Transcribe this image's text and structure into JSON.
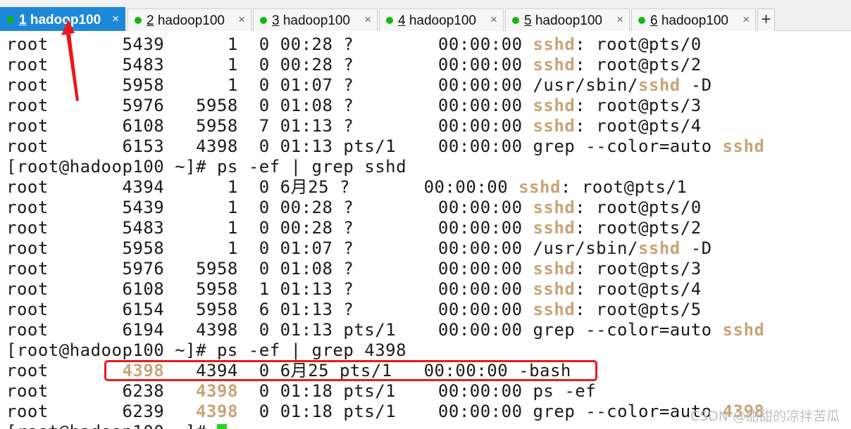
{
  "tabs": [
    {
      "num": "1",
      "name": "hadoop100",
      "active": true
    },
    {
      "num": "2",
      "name": "hadoop100",
      "active": false
    },
    {
      "num": "3",
      "name": "hadoop100",
      "active": false
    },
    {
      "num": "4",
      "name": "hadoop100",
      "active": false
    },
    {
      "num": "5",
      "name": "hadoop100",
      "active": false
    },
    {
      "num": "6",
      "name": "hadoop100",
      "active": false
    }
  ],
  "close_glyph": "×",
  "new_tab_glyph": "+",
  "colors": {
    "active_tab": "#1e88d8",
    "status_dot": "#13b613",
    "highlight": "#c9a477",
    "cursor": "#1ed81e",
    "annotation": "#e8191c"
  },
  "icons": {
    "tab_status": "green-dot-icon",
    "tab_close": "close-icon",
    "new_tab": "plus-icon",
    "annotation": "red-arrow-icon"
  },
  "terminal": {
    "lines": [
      [
        {
          "t": "root       5439      1  0 00:28 ?        00:00:00 "
        },
        {
          "t": "sshd",
          "hl": true
        },
        {
          "t": ": root@pts/0"
        }
      ],
      [
        {
          "t": "root       5483      1  0 00:28 ?        00:00:00 "
        },
        {
          "t": "sshd",
          "hl": true
        },
        {
          "t": ": root@pts/2"
        }
      ],
      [
        {
          "t": "root       5958      1  0 01:07 ?        00:00:00 /usr/sbin/"
        },
        {
          "t": "sshd",
          "hl": true
        },
        {
          "t": " -D"
        }
      ],
      [
        {
          "t": "root       5976   5958  0 01:08 ?        00:00:00 "
        },
        {
          "t": "sshd",
          "hl": true
        },
        {
          "t": ": root@pts/3"
        }
      ],
      [
        {
          "t": "root       6108   5958  7 01:13 ?        00:00:00 "
        },
        {
          "t": "sshd",
          "hl": true
        },
        {
          "t": ": root@pts/4"
        }
      ],
      [
        {
          "t": "root       6153   4398  0 01:13 pts/1    00:00:00 grep --color=auto "
        },
        {
          "t": "sshd",
          "hl": true
        }
      ],
      [
        {
          "t": "[root@hadoop100 ~]# ps -ef | grep sshd"
        }
      ],
      [
        {
          "t": "root       4394      1  0 6月25 ?       00:00:00 "
        },
        {
          "t": "sshd",
          "hl": true
        },
        {
          "t": ": root@pts/1"
        }
      ],
      [
        {
          "t": "root       5439      1  0 00:28 ?        00:00:00 "
        },
        {
          "t": "sshd",
          "hl": true
        },
        {
          "t": ": root@pts/0"
        }
      ],
      [
        {
          "t": "root       5483      1  0 00:28 ?        00:00:00 "
        },
        {
          "t": "sshd",
          "hl": true
        },
        {
          "t": ": root@pts/2"
        }
      ],
      [
        {
          "t": "root       5958      1  0 01:07 ?        00:00:00 /usr/sbin/"
        },
        {
          "t": "sshd",
          "hl": true
        },
        {
          "t": " -D"
        }
      ],
      [
        {
          "t": "root       5976   5958  0 01:08 ?        00:00:00 "
        },
        {
          "t": "sshd",
          "hl": true
        },
        {
          "t": ": root@pts/3"
        }
      ],
      [
        {
          "t": "root       6108   5958  1 01:13 ?        00:00:00 "
        },
        {
          "t": "sshd",
          "hl": true
        },
        {
          "t": ": root@pts/4"
        }
      ],
      [
        {
          "t": "root       6154   5958  6 01:13 ?        00:00:00 "
        },
        {
          "t": "sshd",
          "hl": true
        },
        {
          "t": ": root@pts/5"
        }
      ],
      [
        {
          "t": "root       6194   4398  0 01:13 pts/1    00:00:00 grep --color=auto "
        },
        {
          "t": "sshd",
          "hl": true
        }
      ],
      [
        {
          "t": "[root@hadoop100 ~]# ps -ef | grep 4398"
        }
      ],
      [
        {
          "t": "root       "
        },
        {
          "t": "4398",
          "hl": true
        },
        {
          "t": "   4394  0 6月25 pts/1   00:00:00 -bash"
        }
      ],
      [
        {
          "t": "root       6238   "
        },
        {
          "t": "4398",
          "hl": true
        },
        {
          "t": "  0 01:18 pts/1    00:00:00 ps -ef"
        }
      ],
      [
        {
          "t": "root       6239   "
        },
        {
          "t": "4398",
          "hl": true
        },
        {
          "t": "  0 01:18 pts/1    00:00:00 grep --color=auto "
        },
        {
          "t": "4398",
          "hl": true
        }
      ],
      [
        {
          "t": "[root@hadoop100 ~]# "
        },
        {
          "cursor": true
        }
      ]
    ]
  },
  "watermark": "CSDN @甜甜的凉拌苦瓜"
}
